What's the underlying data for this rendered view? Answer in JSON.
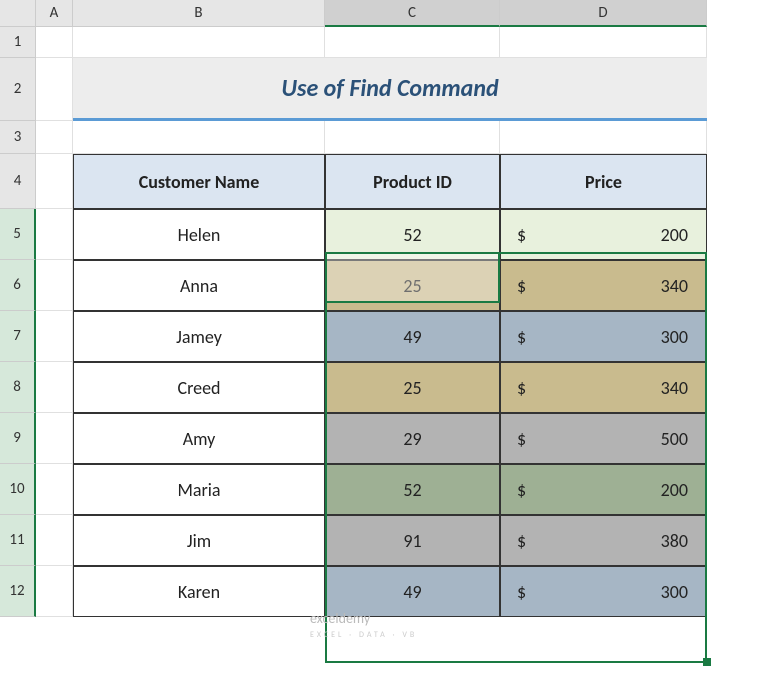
{
  "columns": [
    "",
    "A",
    "B",
    "C",
    "D"
  ],
  "rows": [
    "1",
    "2",
    "3",
    "4",
    "5",
    "6",
    "7",
    "8",
    "9",
    "10",
    "11",
    "12"
  ],
  "title": "Use of Find Command",
  "headers": {
    "name": "Customer Name",
    "pid": "Product ID",
    "price": "Price"
  },
  "chart_data": {
    "type": "table",
    "columns": [
      "Customer Name",
      "Product ID",
      "Price"
    ],
    "rows": [
      {
        "name": "Helen",
        "pid": 52,
        "price": 200,
        "color": "palegreen"
      },
      {
        "name": "Anna",
        "pid": 25,
        "price": 340,
        "color": "tan"
      },
      {
        "name": "Jamey",
        "pid": 49,
        "price": 300,
        "color": "slate"
      },
      {
        "name": "Creed",
        "pid": 25,
        "price": 340,
        "color": "tan"
      },
      {
        "name": "Amy",
        "pid": 29,
        "price": 500,
        "color": "grey"
      },
      {
        "name": "Maria",
        "pid": 52,
        "price": 200,
        "color": "sage"
      },
      {
        "name": "Jim",
        "pid": 91,
        "price": 380,
        "color": "grey"
      },
      {
        "name": "Karen",
        "pid": 49,
        "price": 300,
        "color": "slate"
      }
    ]
  },
  "currency": "$",
  "watermark": "exceldemy",
  "watermark2": "EXCEL · DATA · VB"
}
